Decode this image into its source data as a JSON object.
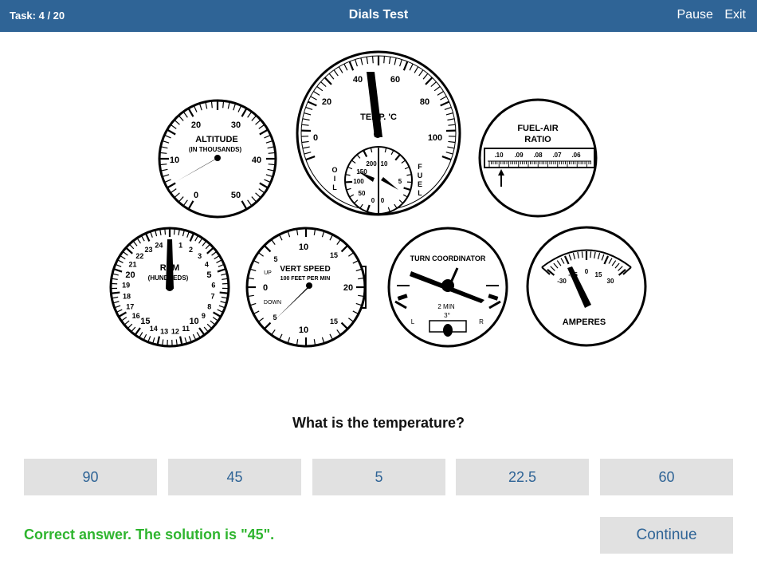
{
  "header": {
    "task": "Task: 4 / 20",
    "title": "Dials Test",
    "pause": "Pause",
    "exit": "Exit"
  },
  "dials": {
    "altitude": {
      "title": "ALTITUDE",
      "subtitle": "(IN THOUSANDS)",
      "labels": [
        "0",
        "10",
        "20",
        "30",
        "40",
        "50"
      ]
    },
    "temperature": {
      "title": "TEMP. 'C",
      "labels": [
        "0",
        "20",
        "40",
        "60",
        "80",
        "100"
      ],
      "sub_oil": "OIL",
      "sub_fuel": "FUEL",
      "sub_labels": [
        "200",
        "150",
        "100",
        "50",
        "0",
        "0",
        "10",
        "5"
      ]
    },
    "fuel_air": {
      "title": "FUEL-AIR",
      "title2": "RATIO",
      "labels": [
        ".10",
        ".09",
        ".08",
        ".07",
        ".06"
      ]
    },
    "rpm": {
      "title": "RPM",
      "subtitle": "(HUNDREDS)",
      "labels": [
        "0",
        "1",
        "2",
        "3",
        "4",
        "5",
        "6",
        "7",
        "8",
        "9",
        "10",
        "11",
        "12",
        "13",
        "14",
        "15",
        "16",
        "17",
        "18",
        "19",
        "20",
        "21",
        "22",
        "23",
        "24"
      ]
    },
    "vert_speed": {
      "title": "VERT SPEED",
      "subtitle": "100 FEET PER MIN",
      "up": "UP",
      "down": "DOWN",
      "labels": [
        "10",
        "15",
        "20",
        "15",
        "10",
        "5",
        "0",
        "5"
      ]
    },
    "turn_coord": {
      "title": "TURN COORDINATOR",
      "min": "2 MIN",
      "deg": "3°",
      "left": "L",
      "right": "R"
    },
    "amperes": {
      "title": "AMPERES",
      "labels": [
        "-30",
        "-15",
        "0",
        "15",
        "30"
      ]
    }
  },
  "question": "What is the temperature?",
  "answers": [
    "90",
    "45",
    "5",
    "22.5",
    "60"
  ],
  "feedback": "Correct answer. The solution is \"45\".",
  "continue": "Continue"
}
